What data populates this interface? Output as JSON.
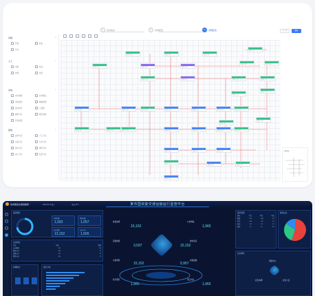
{
  "designer": {
    "steps": [
      {
        "label": "基本信息",
        "num": "1"
      },
      {
        "label": "表单配置",
        "num": "2"
      },
      {
        "label": "流程配置",
        "num": "3"
      }
    ],
    "header_buttons": [
      {
        "label": "上一步"
      },
      {
        "label": "保存"
      }
    ],
    "palette": {
      "sections": [
        {
          "title": "基础",
          "items": [
            "开始",
            "结束",
            "分支",
            "合并"
          ]
        },
        {
          "title": "人工",
          "items": [
            "审批",
            "抄送",
            "办理",
            "会签"
          ]
        },
        {
          "title": "系统",
          "items": [
            "条件判断",
            "并行网关",
            "消息通知",
            "数据处理",
            "定时任务",
            "子流程",
            "脚本节点",
            "服务调用",
            "异常处理"
          ]
        },
        {
          "title": "其他",
          "items": [
            "表单节点",
            "人工节点",
            "自动节点",
            "分支节点",
            "延时节点",
            "事件节点",
            "嵌入节点",
            "结束节点"
          ]
        }
      ]
    },
    "node_label": "节点",
    "node_sub": "审批人:张三",
    "minimap_label": "缩略图"
  },
  "dashboard": {
    "org": "某市国资交通运输局",
    "date": "2023-05-17 周三",
    "weather": "多云 26°C",
    "title": "某市国资委交通运输运行监管平台",
    "left_panels": {
      "overview": "运营概况",
      "kpis": [
        {
          "label": "车辆总数",
          "value": "1,582"
        },
        {
          "label": "线路总数",
          "value": "1,057"
        },
        {
          "label": "站点总数",
          "value": "13,152"
        },
        {
          "label": "从业人员",
          "value": "1,565"
        }
      ],
      "table_title": "企业排名",
      "table_rows": [
        [
          "企业",
          "车辆",
          "线路"
        ],
        [
          "公交集团",
          "520",
          "86"
        ],
        [
          "客运公司",
          "318",
          "42"
        ],
        [
          "出租公司",
          "210",
          "18"
        ],
        [
          "物流公司",
          "150",
          "12"
        ]
      ],
      "bar_title": "运力分布",
      "small_panel_title": "车辆统计"
    },
    "center": {
      "items": [
        {
          "label": "客运站场",
          "value": "15,152"
        },
        {
          "label": "公交场站",
          "value": "1,965"
        },
        {
          "label": "货运枢纽",
          "value": "3,597"
        },
        {
          "label": "城市轨道",
          "value": "15,152"
        },
        {
          "label": "公路里程",
          "value": "15,152"
        },
        {
          "label": "水路运输",
          "value": "5,957"
        },
        {
          "label": "综合服务",
          "value": "1,965"
        },
        {
          "label": "港口码头",
          "value": "1,965"
        }
      ]
    },
    "right_panels": {
      "table_title": "运行监测",
      "table_rows": [
        [
          "指标",
          "今日",
          "昨日",
          "同比"
        ],
        [
          "客流",
          "520",
          "498",
          "4%"
        ],
        [
          "车次",
          "318",
          "310",
          "2%"
        ],
        [
          "准点",
          "96",
          "95",
          "1%"
        ],
        [
          "投诉",
          "12",
          "15",
          "-3%"
        ]
      ],
      "pie_title": "客流占比",
      "pie": [
        {
          "name": "公交",
          "value": 0.55,
          "color": "#e8423c"
        },
        {
          "name": "地铁",
          "value": 0.3,
          "color": "#2ec58a"
        },
        {
          "name": "出租",
          "value": 0.15,
          "color": "#2b8cf0"
        }
      ],
      "bottom_title": "应急事件",
      "bottom_items": [
        "调度中心",
        "应急车辆",
        "应急人员"
      ]
    }
  }
}
